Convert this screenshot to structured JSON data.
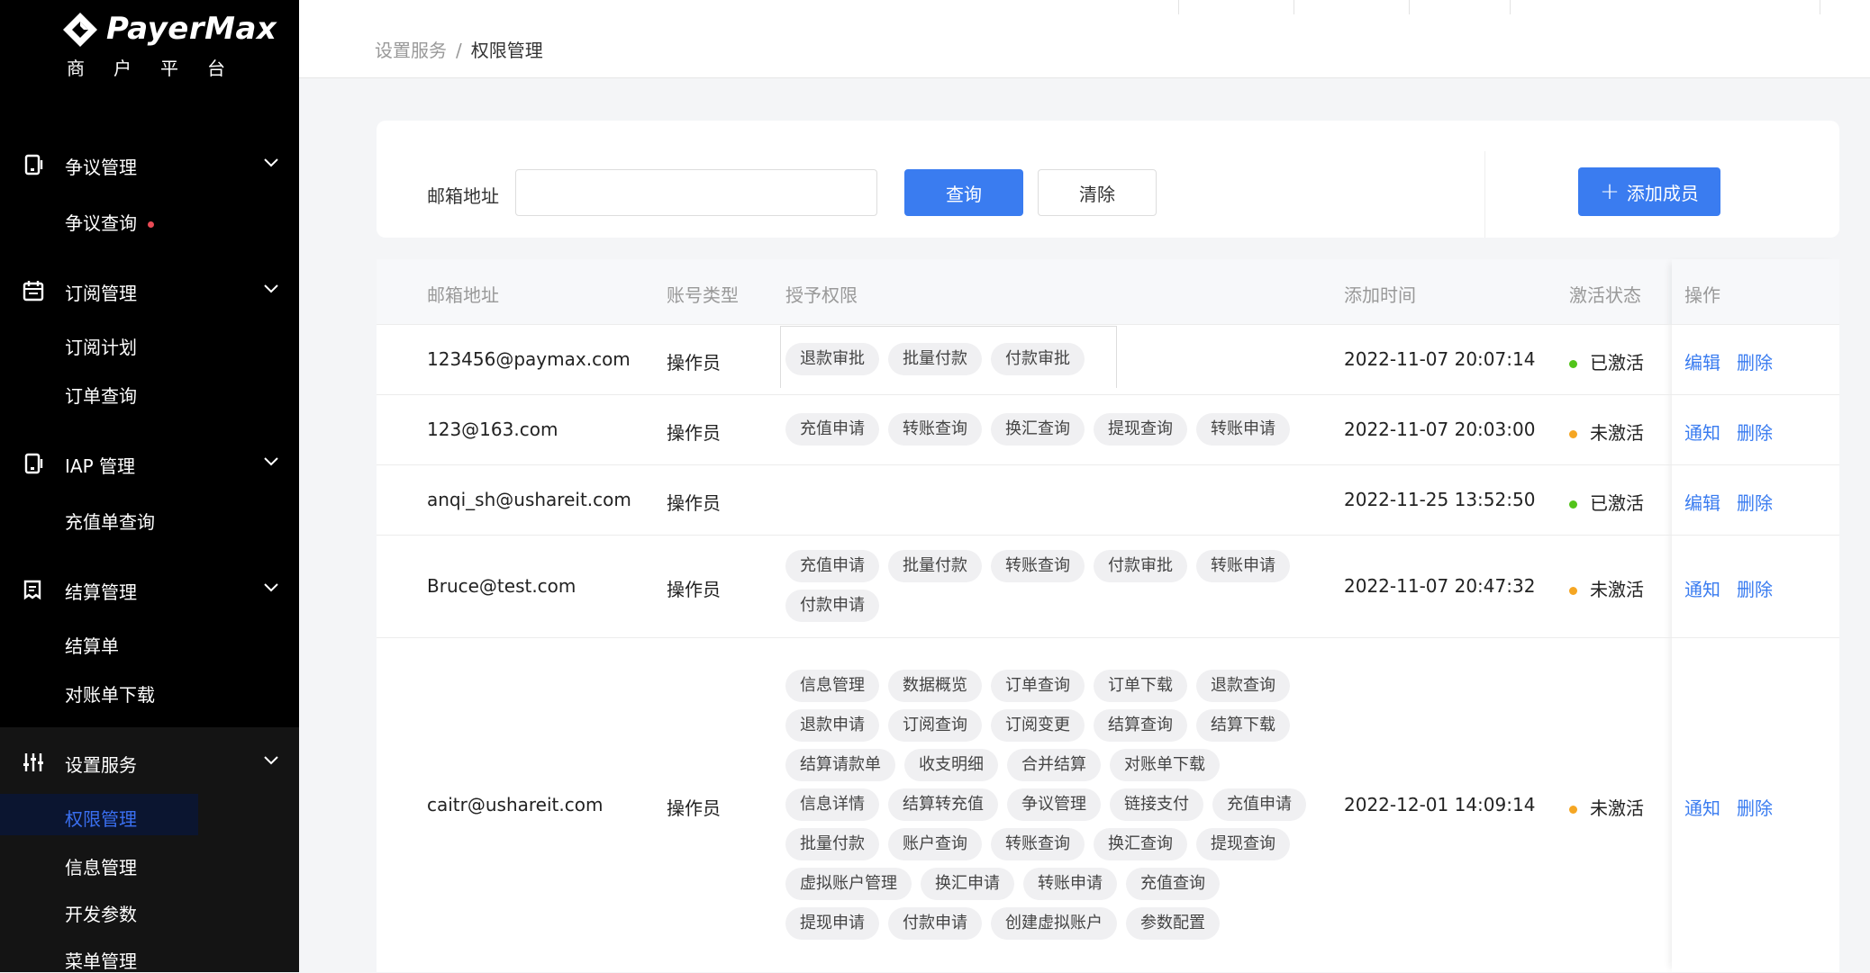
{
  "brand": {
    "name": "PayerMax",
    "subtitle": "商户平台"
  },
  "sidebar": {
    "groups": [
      {
        "label": "争议管理",
        "icon": "phone-icon",
        "items": [
          "争议查询"
        ]
      },
      {
        "label": "订阅管理",
        "icon": "calendar-icon",
        "items": [
          "订阅计划",
          "订单查询"
        ]
      },
      {
        "label": "IAP 管理",
        "icon": "phone-icon",
        "items": [
          "充值单查询"
        ]
      },
      {
        "label": "结算管理",
        "icon": "receipt-icon",
        "items": [
          "结算单",
          "对账单下载"
        ]
      },
      {
        "label": "设置服务",
        "icon": "sliders-icon",
        "items": [
          "权限管理",
          "信息管理",
          "开发参数",
          "菜单管理"
        ]
      }
    ],
    "active_item": "权限管理"
  },
  "breadcrumb": {
    "parent": "设置服务",
    "separator": "/",
    "current": "权限管理"
  },
  "filter": {
    "email_label": "邮箱地址",
    "email_value": "",
    "query_button": "查询",
    "clear_button": "清除",
    "add_button": "添加成员"
  },
  "table": {
    "columns": [
      "邮箱地址",
      "账号类型",
      "授予权限",
      "添加时间",
      "激活状态",
      "操作"
    ],
    "rows": [
      {
        "email": "123456@paymax.com",
        "type": "操作员",
        "permissions": [
          "退款审批",
          "批量付款",
          "付款审批"
        ],
        "time": "2022-11-07 20:07:14",
        "status": "已激活",
        "status_color": "#52c41a",
        "actions": [
          "编辑",
          "删除"
        ]
      },
      {
        "email": "123@163.com",
        "type": "操作员",
        "permissions": [
          "充值申请",
          "转账查询",
          "换汇查询",
          "提现查询",
          "转账申请"
        ],
        "time": "2022-11-07 20:03:00",
        "status": "未激活",
        "status_color": "#f5a623",
        "actions": [
          "通知",
          "删除"
        ]
      },
      {
        "email": "anqi_sh@ushareit.com",
        "type": "操作员",
        "permissions": [],
        "time": "2022-11-25 13:52:50",
        "status": "已激活",
        "status_color": "#52c41a",
        "actions": [
          "编辑",
          "删除"
        ]
      },
      {
        "email": "Bruce@test.com",
        "type": "操作员",
        "permissions": [
          "充值申请",
          "批量付款",
          "转账查询",
          "付款审批",
          "转账申请",
          "付款申请"
        ],
        "time": "2022-11-07 20:47:32",
        "status": "未激活",
        "status_color": "#f5a623",
        "actions": [
          "通知",
          "删除"
        ]
      },
      {
        "email": "caitr@ushareit.com",
        "type": "操作员",
        "permissions": [
          "信息管理",
          "数据概览",
          "订单查询",
          "订单下载",
          "退款查询",
          "退款申请",
          "订阅查询",
          "订阅变更",
          "结算查询",
          "结算下载",
          "结算请款单",
          "收支明细",
          "合并结算",
          "对账单下载",
          "信息详情",
          "结算转充值",
          "争议管理",
          "链接支付",
          "充值申请",
          "批量付款",
          "账户查询",
          "转账查询",
          "换汇查询",
          "提现查询",
          "虚拟账户管理",
          "换汇申请",
          "转账申请",
          "充值查询",
          "提现申请",
          "付款申请",
          "创建虚拟账户",
          "参数配置"
        ],
        "time": "2022-12-01 14:09:14",
        "status": "未激活",
        "status_color": "#f5a623",
        "actions": [
          "通知",
          "删除"
        ]
      }
    ]
  }
}
